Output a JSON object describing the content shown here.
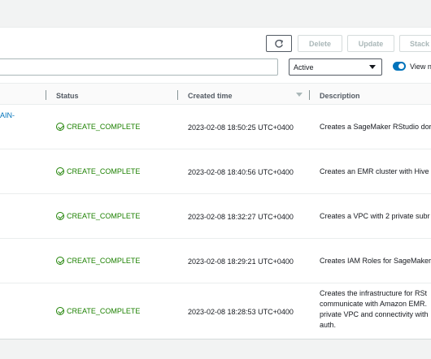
{
  "toolbar": {
    "refresh_icon": "refresh-icon",
    "delete_label": "Delete",
    "update_label": "Update",
    "stack_actions_label": "Stack"
  },
  "filters": {
    "search_value": "",
    "status_selected": "Active",
    "view_toggle_label": "View n"
  },
  "table": {
    "columns": [
      "Status",
      "Created time",
      "Description"
    ],
    "rows": [
      {
        "name_fragment": "AIN-",
        "status": "CREATE_COMPLETE",
        "created": "2023-02-08 18:50:25 UTC+0400",
        "description": "Creates a SageMaker RStudio dor"
      },
      {
        "name_fragment": "",
        "status": "CREATE_COMPLETE",
        "created": "2023-02-08 18:40:56 UTC+0400",
        "description": "Creates an EMR cluster with Hive"
      },
      {
        "name_fragment": "",
        "status": "CREATE_COMPLETE",
        "created": "2023-02-08 18:32:27 UTC+0400",
        "description": "Creates a VPC with 2 private subr"
      },
      {
        "name_fragment": "",
        "status": "CREATE_COMPLETE",
        "created": "2023-02-08 18:29:21 UTC+0400",
        "description": "Creates IAM Roles for SageMaker"
      },
      {
        "name_fragment": "",
        "status": "CREATE_COMPLETE",
        "created": "2023-02-08 18:28:53 UTC+0400",
        "description_lines": [
          "Creates the infrastructure for RSt",
          "communicate with Amazon EMR.",
          "private VPC and connectivity with",
          "auth."
        ]
      }
    ]
  },
  "colors": {
    "link": "#0073bb",
    "success": "#1d8102",
    "toggle_on": "#0073bb"
  }
}
